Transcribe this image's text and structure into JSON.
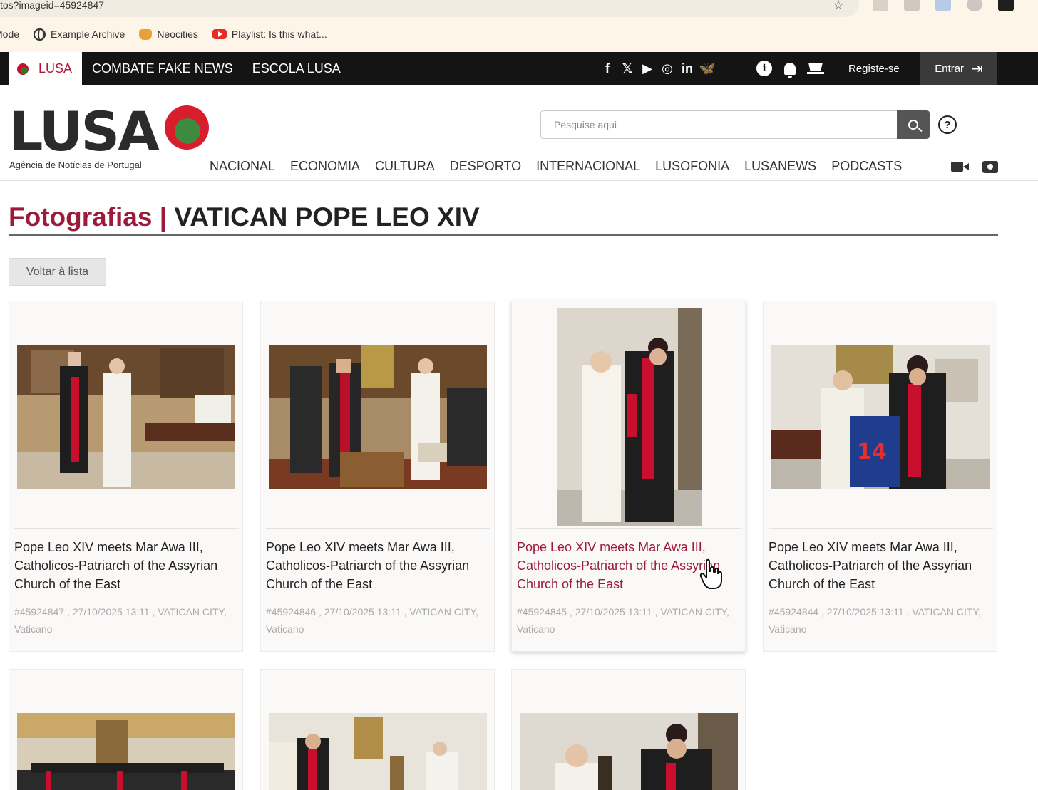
{
  "browser": {
    "url_fragment": "tos?imageid=45924847",
    "bookmarks": [
      {
        "label": "Mode",
        "icon": "none"
      },
      {
        "label": "Example Archive",
        "icon": "globe-icon"
      },
      {
        "label": "Neocities",
        "icon": "cat-icon"
      },
      {
        "label": "Playlist: Is this what...",
        "icon": "youtube-icon"
      }
    ]
  },
  "topbar": {
    "brand_label": "LUSA",
    "nav": [
      "COMBATE FAKE NEWS",
      "ESCOLA LUSA"
    ],
    "socials": [
      "f",
      "𝕏",
      "▶",
      "◎",
      "in",
      "🦋"
    ],
    "register_label": "Registe-se",
    "login_label": "Entrar"
  },
  "header": {
    "logo_word": "LUSA",
    "logo_subtitle": "Agência de Notícias de Portugal",
    "search_placeholder": "Pesquise aqui",
    "help_glyph": "?",
    "nav": [
      "NACIONAL",
      "ECONOMIA",
      "CULTURA",
      "DESPORTO",
      "INTERNACIONAL",
      "LUSOFONIA",
      "LUSANEWS",
      "PODCASTS"
    ]
  },
  "page": {
    "section": "Fotografias |",
    "title": "VATICAN POPE LEO XIV",
    "back_label": "Voltar à lista"
  },
  "photos": [
    {
      "caption": "Pope Leo XIV meets Mar Awa III, Catholicos-Patriarch of the Assyrian Church of the East",
      "meta": "#45924847 , 27/10/2025 13:11 , VATICAN CITY, Vaticano"
    },
    {
      "caption": "Pope Leo XIV meets Mar Awa III, Catholicos-Patriarch of the Assyrian Church of the East",
      "meta": "#45924846 , 27/10/2025 13:11 , VATICAN CITY, Vaticano"
    },
    {
      "caption": "Pope Leo XIV meets Mar Awa III, Catholicos-Patriarch of the Assyrian Church of the East",
      "meta": "#45924845 , 27/10/2025 13:11 , VATICAN CITY, Vaticano"
    },
    {
      "caption": "Pope Leo XIV meets Mar Awa III, Catholicos-Patriarch of the Assyrian Church of the East",
      "meta": "#45924844 , 27/10/2025 13:11 , VATICAN CITY, Vaticano"
    }
  ],
  "colors": {
    "brand_red": "#9b1b3b",
    "topbar_bg": "#141414",
    "logo_red": "#d81e2c",
    "logo_green": "#2e7d32"
  }
}
